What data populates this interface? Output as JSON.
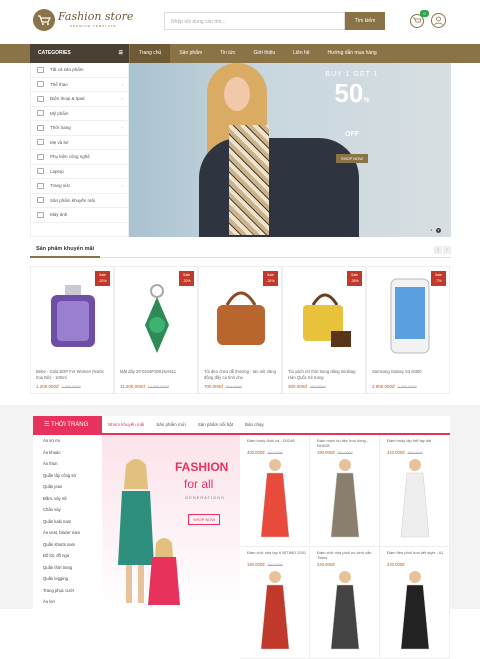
{
  "brand": {
    "name": "Fashion store",
    "sub": "PREMIUM TEMPLATE",
    "color": "#8b7348"
  },
  "search": {
    "placeholder": "Nhập nội dung cần tìm...",
    "button": "Tìm kiếm"
  },
  "cart": {
    "count": "0"
  },
  "categories": {
    "title": "CATEGORIES",
    "items": [
      {
        "label": "Tất cả sản phẩm",
        "arrow": false
      },
      {
        "label": "Thể thao",
        "arrow": true
      },
      {
        "label": "Điện thoại & Ipad",
        "arrow": true
      },
      {
        "label": "Mỹ phẩm",
        "arrow": false
      },
      {
        "label": "Thời trang",
        "arrow": true
      },
      {
        "label": "Mẹ và bé",
        "arrow": false
      },
      {
        "label": "Phụ kiện công nghệ",
        "arrow": false
      },
      {
        "label": "Laptop",
        "arrow": false
      },
      {
        "label": "Trang sức",
        "arrow": true
      },
      {
        "label": "Sản phẩm khuyến mãi",
        "arrow": false
      },
      {
        "label": "Máy ảnh",
        "arrow": false
      }
    ]
  },
  "nav": [
    "Trang chủ",
    "Sản phẩm",
    "Tin tức",
    "Giới thiệu",
    "Liên hệ",
    "Hướng dẫn mua hàng"
  ],
  "banner": {
    "line1": "BUY 1 GET 1",
    "big": "50",
    "pct": "%",
    "off": "OFF",
    "shop": "SHOP NOW",
    "dots": [
      "1",
      "2"
    ]
  },
  "promo_section": {
    "title": "Sản phẩm khuyến mãi",
    "products": [
      {
        "name": "Bebe - Gold EDP For Women (Nước hoa Nữ) - 100ml",
        "price": "1.200.000đ",
        "old": "1.500.000đ",
        "sale": "-20%"
      },
      {
        "name": "Mặt dây 20-0216P3001NA611",
        "price": "11.200.000đ",
        "old": "14.000.000đ",
        "sale": "-20%"
      },
      {
        "name": "Túi đeo chéo dễ thương - tao nét năng động đầy cá tính cho",
        "price": "700.000đ",
        "old": "920.000đ",
        "sale": "-24%"
      },
      {
        "name": "Túi xách nữ thời trang dáng minibag Hàn Quốc trẻ trung",
        "price": "300.000đ",
        "old": "700.000đ",
        "sale": "-28%"
      },
      {
        "name": "Samsung Galaxy S3 i9300",
        "price": "3.900.000đ",
        "old": "4.200.000đ",
        "sale": "-7%"
      }
    ]
  },
  "fashion": {
    "title": "THỜI TRANG",
    "tabs": [
      "Nhóm khuyến mãi",
      "Sản phẩm mới",
      "Sản phẩm nổi bật",
      "Bán chạy"
    ],
    "side": [
      "Áo sơ mi",
      "Áo khoác",
      "Áo thun",
      "Quần tây công sở",
      "Quần jean",
      "Đầm, váy nữ",
      "Chân váy",
      "Quần kaki nam",
      "Áo vest, blazer nam",
      "Quần shorts nam",
      "Đồ lót, đồ ngủ",
      "Quần thời trang",
      "Quần legging",
      "Trang phục cưới",
      "Áo len"
    ],
    "banner": {
      "l1": "FASHION",
      "l2": "for all",
      "l3": "GENERATIONS",
      "l4": "SHOP NOW"
    },
    "grid": [
      {
        "name": "Đầm body đuôi cá - D0248",
        "price": "400.000đ",
        "old": "450.000đ"
      },
      {
        "name": "Đầm maxi du tiệc hoa hồng - NH028",
        "price": "190.000đ",
        "old": "260.000đ"
      },
      {
        "name": "Đầm body lập thể tay dài",
        "price": "310.000đ",
        "old": "360.000đ"
      },
      {
        "name": "Đầm chữ nhà tay ô NITIMO 2001",
        "price": "190.000đ",
        "old": "260.000đ"
      },
      {
        "name": "Đầm chữ nhà phối no xinh xắn Twins",
        "price": "240.000đ",
        "old": ""
      },
      {
        "name": "Đầm đen phối hoa tiết style - A1",
        "price": "220.000đ",
        "old": ""
      }
    ]
  }
}
